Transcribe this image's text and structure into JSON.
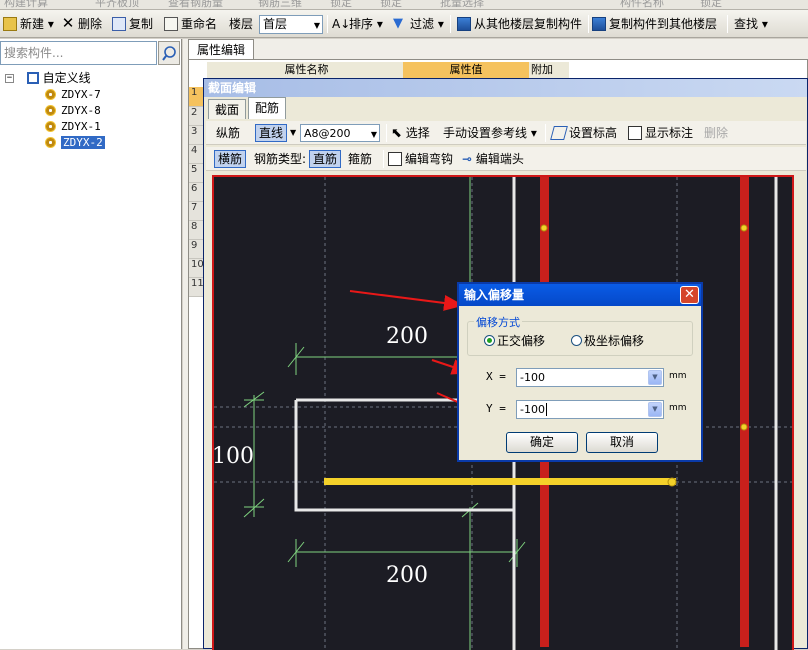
{
  "top_strip": [
    "构建计算",
    "平齐板顶",
    "查看钢筋量",
    "钢筋三维",
    "锁定",
    "锁定",
    "批量选择",
    "构件名称",
    "锁定"
  ],
  "toolbar": {
    "new": "新建",
    "delete": "删除",
    "copy": "复制",
    "rename": "重命名",
    "floor_label": "楼层",
    "floor_value": "首层",
    "sort": "排序",
    "filter": "过滤",
    "copy_from_floor": "从其他楼层复制构件",
    "copy_to_floor": "复制构件到其他楼层",
    "find": "查找"
  },
  "left": {
    "search_placeholder": "搜索构件...",
    "tree_root": "自定义线",
    "items": [
      "ZDYX-7",
      "ZDYX-8",
      "ZDYX-1",
      "ZDYX-2"
    ],
    "selected": "ZDYX-2"
  },
  "props": {
    "tab": "属性编辑",
    "col_name": "属性名称",
    "col_value": "属性值",
    "col_extra": "附加",
    "row_numbers": [
      "1",
      "2",
      "3",
      "4",
      "5",
      "6",
      "7",
      "8",
      "9",
      "10",
      "11"
    ]
  },
  "editor": {
    "title": "截面编辑",
    "tabs": [
      "截面",
      "配筋"
    ],
    "row1": {
      "longitudinal": "纵筋",
      "line": "直线",
      "spec": "A8@200",
      "select": "选择",
      "manual_ref": "手动设置参考线",
      "set_elevation": "设置标高",
      "show_label": "显示标注",
      "delete": "删除"
    },
    "row2": {
      "transverse": "横筋",
      "type_label": "钢筋类型:",
      "straight": "直筋",
      "stirrup": "箍筋",
      "edit_hook": "编辑弯钩",
      "edit_end": "编辑端头"
    },
    "dims": [
      "200",
      "100",
      "200"
    ]
  },
  "dialog": {
    "title": "输入偏移量",
    "group": "偏移方式",
    "opt_ortho": "正交偏移",
    "opt_polar": "极坐标偏移",
    "selected": "正交偏移",
    "x_label": "X =",
    "x_value": "-100",
    "y_label": "Y =",
    "y_value": "-100",
    "unit": "mm",
    "ok": "确定",
    "cancel": "取消"
  },
  "colors": {
    "canvas_bg": "#1c1c24",
    "rebar_red": "#c8201c",
    "rebar_yellow": "#f4d12a",
    "dim_green": "#7fd37f",
    "arrow_red": "#e81818"
  }
}
